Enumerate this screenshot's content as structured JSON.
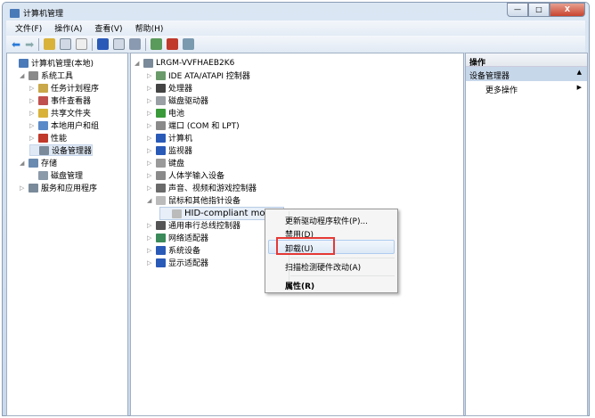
{
  "window": {
    "title": "计算机管理",
    "minimize": "—",
    "maximize": "□",
    "close": "X"
  },
  "menu": [
    "文件(F)",
    "操作(A)",
    "查看(V)",
    "帮助(H)"
  ],
  "left_tree": [
    {
      "label": "计算机管理(本地)",
      "indent": 0,
      "arrow": "",
      "color": "#4a7ab8"
    },
    {
      "label": "系统工具",
      "indent": 1,
      "arrow": "◢",
      "color": "#8a8a8a"
    },
    {
      "label": "任务计划程序",
      "indent": 2,
      "arrow": "▷",
      "color": "#c9a84a"
    },
    {
      "label": "事件查看器",
      "indent": 2,
      "arrow": "▷",
      "color": "#c0504d"
    },
    {
      "label": "共享文件夹",
      "indent": 2,
      "arrow": "▷",
      "color": "#d9b23a"
    },
    {
      "label": "本地用户和组",
      "indent": 2,
      "arrow": "▷",
      "color": "#5a8ac8"
    },
    {
      "label": "性能",
      "indent": 2,
      "arrow": "▷",
      "color": "#c0392b"
    },
    {
      "label": "设备管理器",
      "indent": 2,
      "arrow": "",
      "color": "#7a8a9a",
      "selected": true
    },
    {
      "label": "存储",
      "indent": 1,
      "arrow": "◢",
      "color": "#6a8ab0"
    },
    {
      "label": "磁盘管理",
      "indent": 2,
      "arrow": "",
      "color": "#8a9aa8"
    },
    {
      "label": "服务和应用程序",
      "indent": 1,
      "arrow": "▷",
      "color": "#7a8a9a"
    }
  ],
  "device_tree": {
    "root": "LRGM-VVFHAEB2K6",
    "items": [
      {
        "label": "IDE ATA/ATAPI 控制器",
        "arrow": "▷",
        "color": "#6a9a6a"
      },
      {
        "label": "处理器",
        "arrow": "▷",
        "color": "#444444"
      },
      {
        "label": "磁盘驱动器",
        "arrow": "▷",
        "color": "#9aa0a6"
      },
      {
        "label": "电池",
        "arrow": "▷",
        "color": "#3a9a3a"
      },
      {
        "label": "端口 (COM 和 LPT)",
        "arrow": "▷",
        "color": "#8a8a8a"
      },
      {
        "label": "计算机",
        "arrow": "▷",
        "color": "#2a5ab8"
      },
      {
        "label": "监视器",
        "arrow": "▷",
        "color": "#2a5ab8"
      },
      {
        "label": "键盘",
        "arrow": "▷",
        "color": "#9a9a9a"
      },
      {
        "label": "人体学输入设备",
        "arrow": "▷",
        "color": "#8a8a8a"
      },
      {
        "label": "声音、视频和游戏控制器",
        "arrow": "▷",
        "color": "#6a6a6a"
      },
      {
        "label": "鼠标和其他指针设备",
        "arrow": "◢",
        "color": "#bbbbbb"
      },
      {
        "label": "HID-compliant mouse",
        "arrow": "",
        "color": "#bbbbbb",
        "child": true
      },
      {
        "label": "通用串行总线控制器",
        "arrow": "▷",
        "color": "#555555"
      },
      {
        "label": "网络适配器",
        "arrow": "▷",
        "color": "#3a8a5a"
      },
      {
        "label": "系统设备",
        "arrow": "▷",
        "color": "#2a5ab8"
      },
      {
        "label": "显示适配器",
        "arrow": "▷",
        "color": "#2a5ab8"
      }
    ]
  },
  "actions": {
    "header": "操作",
    "section": "设备管理器",
    "more": "更多操作"
  },
  "context_menu": {
    "update": "更新驱动程序软件(P)...",
    "disable": "禁用(D)",
    "uninstall": "卸载(U)",
    "scan": "扫描检测硬件改动(A)",
    "properties": "属性(R)"
  },
  "colors": {
    "highlight_box": "#e53935",
    "selection": "#dfe9f5"
  }
}
